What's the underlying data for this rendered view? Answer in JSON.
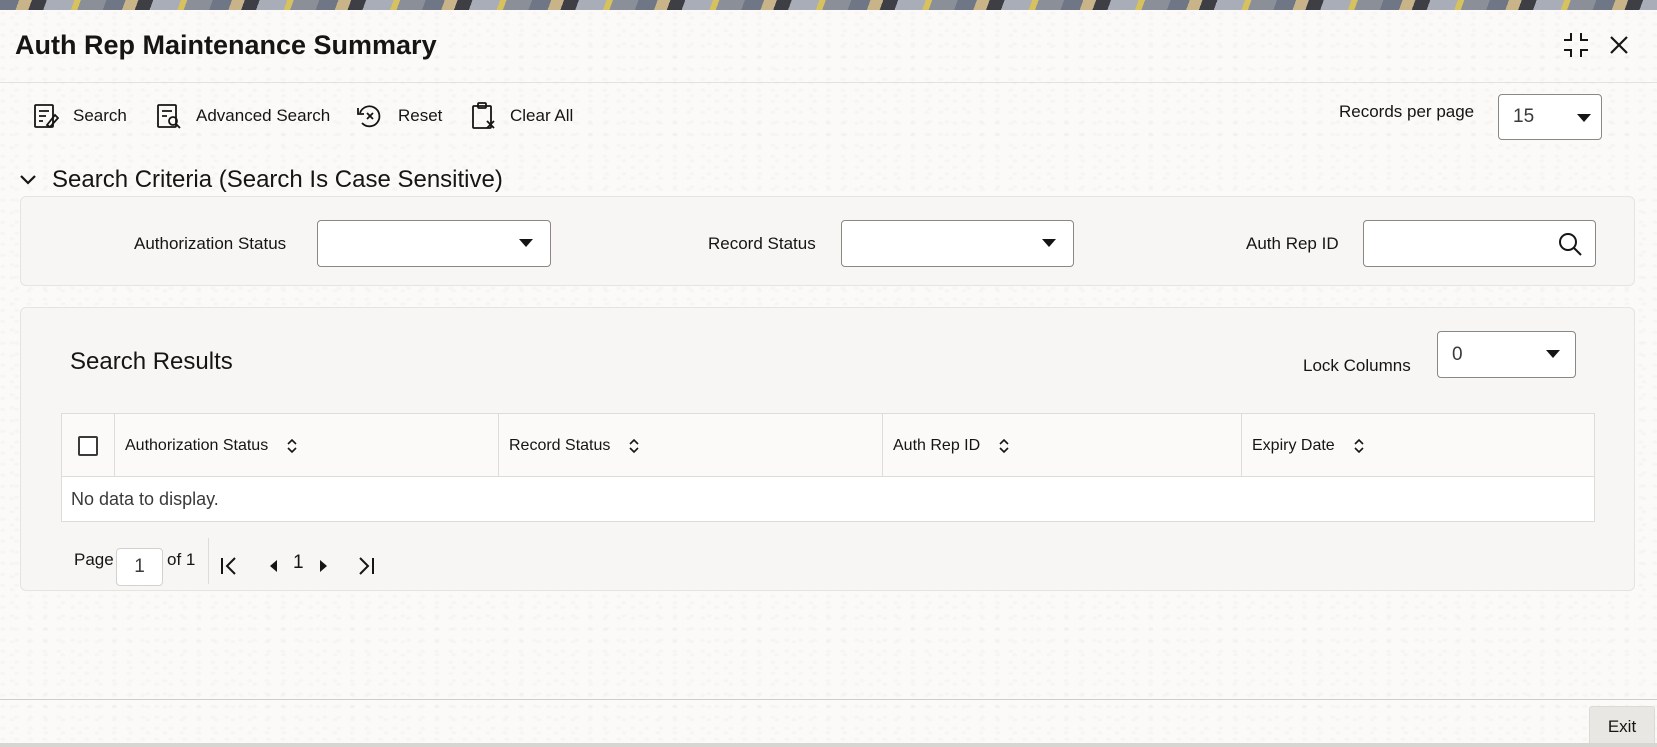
{
  "window": {
    "title": "Auth Rep Maintenance Summary"
  },
  "toolbar": {
    "search_label": "Search",
    "advanced_search_label": "Advanced Search",
    "reset_label": "Reset",
    "clear_all_label": "Clear All",
    "records_per_page_label": "Records per page",
    "records_per_page_value": "15"
  },
  "search_criteria": {
    "title": "Search Criteria (Search Is Case Sensitive)",
    "authorization_status_label": "Authorization Status",
    "authorization_status_value": "",
    "record_status_label": "Record Status",
    "record_status_value": "",
    "auth_rep_id_label": "Auth Rep ID",
    "auth_rep_id_value": ""
  },
  "results": {
    "title": "Search Results",
    "lock_columns_label": "Lock Columns",
    "lock_columns_value": "0",
    "columns": [
      "Authorization Status",
      "Record Status",
      "Auth Rep ID",
      "Expiry Date"
    ],
    "empty_message": "No data to display."
  },
  "pagination": {
    "page_label": "Page",
    "current_page": "1",
    "of_label": "of 1",
    "page_number": "1"
  },
  "footer": {
    "exit_label": "Exit"
  }
}
